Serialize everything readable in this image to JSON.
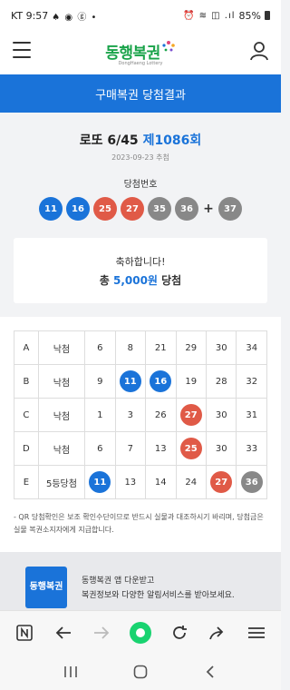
{
  "status": {
    "carrier_time": "KT 9:57",
    "left_icons": "♠ ◉ ⓖ •",
    "right_icons": "⏰ ≋ ◫ .ıl",
    "battery": "85%"
  },
  "header": {
    "logo_text": "동행복권",
    "logo_sub": "DongHaeng Lottery",
    "page_title": "구매복권 당첨결과"
  },
  "summary": {
    "round_prefix": "로또 6/45 ",
    "round": "제1086회",
    "draw_date": "2023-09-23 추첨",
    "winning_label": "당첨번호",
    "plus": "+",
    "winning_numbers": [
      {
        "n": "11",
        "color": "#1a73d9"
      },
      {
        "n": "16",
        "color": "#1a73d9"
      },
      {
        "n": "25",
        "color": "#e05a47"
      },
      {
        "n": "27",
        "color": "#e05a47"
      },
      {
        "n": "35",
        "color": "#888888"
      },
      {
        "n": "36",
        "color": "#888888"
      }
    ],
    "bonus": {
      "n": "37",
      "color": "#888888"
    },
    "congrats": "축하합니다!",
    "prize_prefix": "총 ",
    "prize_amount": "5,000원",
    "prize_suffix": " 당첨"
  },
  "tickets": [
    {
      "letter": "A",
      "result": "낙첨",
      "numbers": [
        {
          "n": "6"
        },
        {
          "n": "8"
        },
        {
          "n": "21"
        },
        {
          "n": "29"
        },
        {
          "n": "30"
        },
        {
          "n": "34"
        }
      ]
    },
    {
      "letter": "B",
      "result": "낙첨",
      "numbers": [
        {
          "n": "9"
        },
        {
          "n": "11",
          "color": "#1a73d9"
        },
        {
          "n": "16",
          "color": "#1a73d9"
        },
        {
          "n": "19"
        },
        {
          "n": "28"
        },
        {
          "n": "32"
        }
      ]
    },
    {
      "letter": "C",
      "result": "낙첨",
      "numbers": [
        {
          "n": "1"
        },
        {
          "n": "3"
        },
        {
          "n": "26"
        },
        {
          "n": "27",
          "color": "#e05a47"
        },
        {
          "n": "30"
        },
        {
          "n": "31"
        }
      ]
    },
    {
      "letter": "D",
      "result": "낙첨",
      "numbers": [
        {
          "n": "6"
        },
        {
          "n": "7"
        },
        {
          "n": "13"
        },
        {
          "n": "25",
          "color": "#e05a47"
        },
        {
          "n": "30"
        },
        {
          "n": "33"
        }
      ]
    },
    {
      "letter": "E",
      "result": "5등당첨",
      "numbers": [
        {
          "n": "11",
          "color": "#1a73d9"
        },
        {
          "n": "13"
        },
        {
          "n": "14"
        },
        {
          "n": "24"
        },
        {
          "n": "27",
          "color": "#e05a47"
        },
        {
          "n": "36",
          "color": "#888888"
        }
      ]
    }
  ],
  "note": "- QR 당첨확인은 보조 확인수단이므로 반드시 실물과 대조하시기 바리며, 당첨금은 실물 복권소지자에게 지급합니다.",
  "banner": {
    "icon_text": "동행\n복권",
    "line1": "동행복권 앱 다운받고",
    "line2": "복권정보와 다양한 알림서비스를 받아보세요."
  },
  "browser_icons": [
    "n-icon",
    "back-arrow-icon",
    "forward-arrow-icon",
    "home-icon",
    "reload-icon",
    "share-icon",
    "menu-icon"
  ],
  "nav_icons": [
    "recent-apps-icon",
    "home-circle-icon",
    "back-chevron-icon"
  ]
}
